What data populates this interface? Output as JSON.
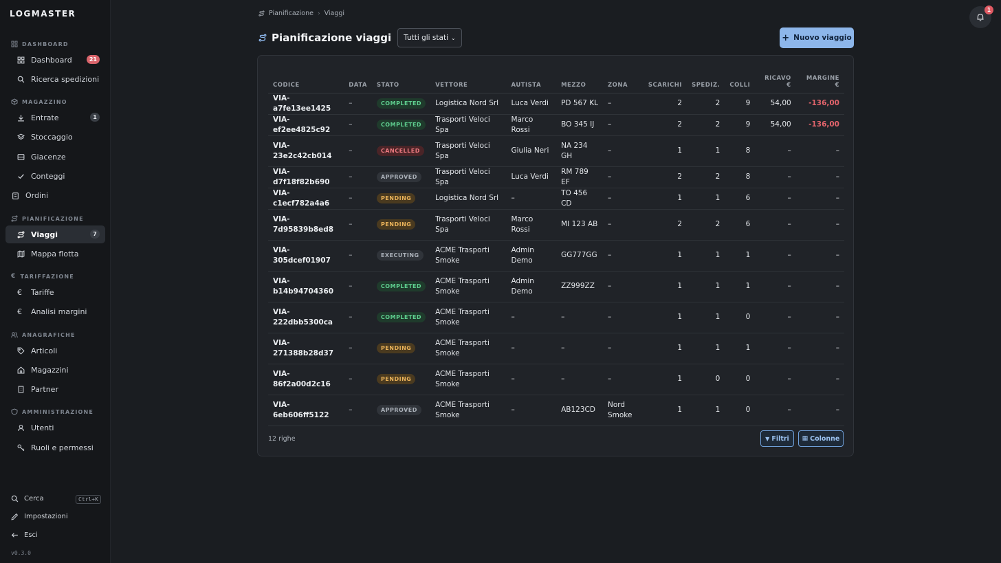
{
  "app": {
    "logo": "LOGMASTER",
    "version": "v0.3.0"
  },
  "sidebar": {
    "sections": {
      "dashboard": "DASHBOARD",
      "magazzino": "MAGAZZINO",
      "pianificazione": "PIANIFICAZIONE",
      "tariffazione": "TARIFFAZIONE",
      "anagrafiche": "ANAGRAFICHE",
      "amministrazione": "AMMINISTRAZIONE"
    },
    "items": {
      "dashboard": {
        "label": "Dashboard",
        "badge": "21"
      },
      "ricerca": {
        "label": "Ricerca spedizioni"
      },
      "entrate": {
        "label": "Entrate",
        "badge": "1"
      },
      "stoccaggio": {
        "label": "Stoccaggio"
      },
      "giacenze": {
        "label": "Giacenze"
      },
      "conteggi": {
        "label": "Conteggi"
      },
      "ordini": {
        "label": "Ordini"
      },
      "viaggi": {
        "label": "Viaggi",
        "badge": "7"
      },
      "mappa": {
        "label": "Mappa flotta"
      },
      "tariffe": {
        "label": "Tariffe"
      },
      "analisi": {
        "label": "Analisi margini"
      },
      "articoli": {
        "label": "Articoli"
      },
      "magazzini": {
        "label": "Magazzini"
      },
      "partner": {
        "label": "Partner"
      },
      "utenti": {
        "label": "Utenti"
      },
      "ruoli": {
        "label": "Ruoli e permessi"
      }
    },
    "bottom": {
      "cerca": "Cerca",
      "shortcut": "Ctrl+K",
      "impostazioni": "Impostazioni",
      "esci": "Esci"
    }
  },
  "header": {
    "breadcrumb": [
      "Pianificazione",
      "Viaggi"
    ],
    "title": "Pianificazione viaggi",
    "status_filter": "Tutti gli stati",
    "new_button": "Nuovo viaggio",
    "notification_count": "1"
  },
  "table": {
    "columns": [
      "CODICE",
      "DATA",
      "STATO",
      "VETTORE",
      "AUTISTA",
      "MEZZO",
      "ZONA",
      "SCARICHI",
      "SPEDIZ.",
      "COLLI",
      "RICAVO €",
      "MARGINE €"
    ],
    "rows": [
      {
        "code": "VIA-a7fe13ee1425",
        "date": "–",
        "status": "COMPLETED",
        "carrier": "Logistica Nord Srl",
        "driver": "Luca Verdi",
        "vehicle": "PD 567 KL",
        "zone": "–",
        "unloads": "2",
        "shipments": "2",
        "packages": "9",
        "revenue": "54,00",
        "margin": "-136,00"
      },
      {
        "code": "VIA-ef2ee4825c92",
        "date": "–",
        "status": "COMPLETED",
        "carrier": "Trasporti Veloci Spa",
        "driver": "Marco Rossi",
        "vehicle": "BO 345 IJ",
        "zone": "–",
        "unloads": "2",
        "shipments": "2",
        "packages": "9",
        "revenue": "54,00",
        "margin": "-136,00"
      },
      {
        "code": "VIA-23e2c42cb014",
        "date": "–",
        "status": "CANCELLED",
        "carrier": "Trasporti Veloci Spa",
        "driver": "Giulia Neri",
        "vehicle": "NA 234 GH",
        "zone": "–",
        "unloads": "1",
        "shipments": "1",
        "packages": "8",
        "revenue": "–",
        "margin": "–"
      },
      {
        "code": "VIA-d7f18f82b690",
        "date": "–",
        "status": "APPROVED",
        "carrier": "Trasporti Veloci Spa",
        "driver": "Luca Verdi",
        "vehicle": "RM 789 EF",
        "zone": "–",
        "unloads": "2",
        "shipments": "2",
        "packages": "8",
        "revenue": "–",
        "margin": "–"
      },
      {
        "code": "VIA-c1ecf782a4a6",
        "date": "–",
        "status": "PENDING",
        "carrier": "Logistica Nord Srl",
        "driver": "–",
        "vehicle": "TO 456 CD",
        "zone": "–",
        "unloads": "1",
        "shipments": "1",
        "packages": "6",
        "revenue": "–",
        "margin": "–"
      },
      {
        "code": "VIA-7d95839b8ed8",
        "date": "–",
        "status": "PENDING",
        "carrier": "Trasporti Veloci Spa",
        "driver": "Marco Rossi",
        "vehicle": "MI 123 AB",
        "zone": "–",
        "unloads": "2",
        "shipments": "2",
        "packages": "6",
        "revenue": "–",
        "margin": "–"
      },
      {
        "code": "VIA-305dcef01907",
        "date": "–",
        "status": "EXECUTING",
        "carrier": "ACME Trasporti Smoke",
        "driver": "Admin Demo",
        "vehicle": "GG777GG",
        "zone": "–",
        "unloads": "1",
        "shipments": "1",
        "packages": "1",
        "revenue": "–",
        "margin": "–"
      },
      {
        "code": "VIA-b14b94704360",
        "date": "–",
        "status": "COMPLETED",
        "carrier": "ACME Trasporti Smoke",
        "driver": "Admin Demo",
        "vehicle": "ZZ999ZZ",
        "zone": "–",
        "unloads": "1",
        "shipments": "1",
        "packages": "1",
        "revenue": "–",
        "margin": "–"
      },
      {
        "code": "VIA-222dbb5300ca",
        "date": "–",
        "status": "COMPLETED",
        "carrier": "ACME Trasporti Smoke",
        "driver": "–",
        "vehicle": "–",
        "zone": "–",
        "unloads": "1",
        "shipments": "1",
        "packages": "0",
        "revenue": "–",
        "margin": "–"
      },
      {
        "code": "VIA-271388b28d37",
        "date": "–",
        "status": "PENDING",
        "carrier": "ACME Trasporti Smoke",
        "driver": "–",
        "vehicle": "–",
        "zone": "–",
        "unloads": "1",
        "shipments": "1",
        "packages": "1",
        "revenue": "–",
        "margin": "–"
      },
      {
        "code": "VIA-86f2a00d2c16",
        "date": "–",
        "status": "PENDING",
        "carrier": "ACME Trasporti Smoke",
        "driver": "–",
        "vehicle": "–",
        "zone": "–",
        "unloads": "1",
        "shipments": "0",
        "packages": "0",
        "revenue": "–",
        "margin": "–"
      },
      {
        "code": "VIA-6eb606ff5122",
        "date": "–",
        "status": "APPROVED",
        "carrier": "ACME Trasporti Smoke",
        "driver": "–",
        "vehicle": "AB123CD",
        "zone": "Nord Smoke",
        "unloads": "1",
        "shipments": "1",
        "packages": "0",
        "revenue": "–",
        "margin": "–"
      }
    ],
    "row_count": "12 righe",
    "filters_button": "Filtri",
    "columns_button": "Colonne"
  },
  "colors": {
    "accent": "#8db6ea",
    "negative": "#e3646c",
    "completed": "#5fcf8f",
    "pending": "#eab35a",
    "cancelled": "#ec7a80"
  }
}
